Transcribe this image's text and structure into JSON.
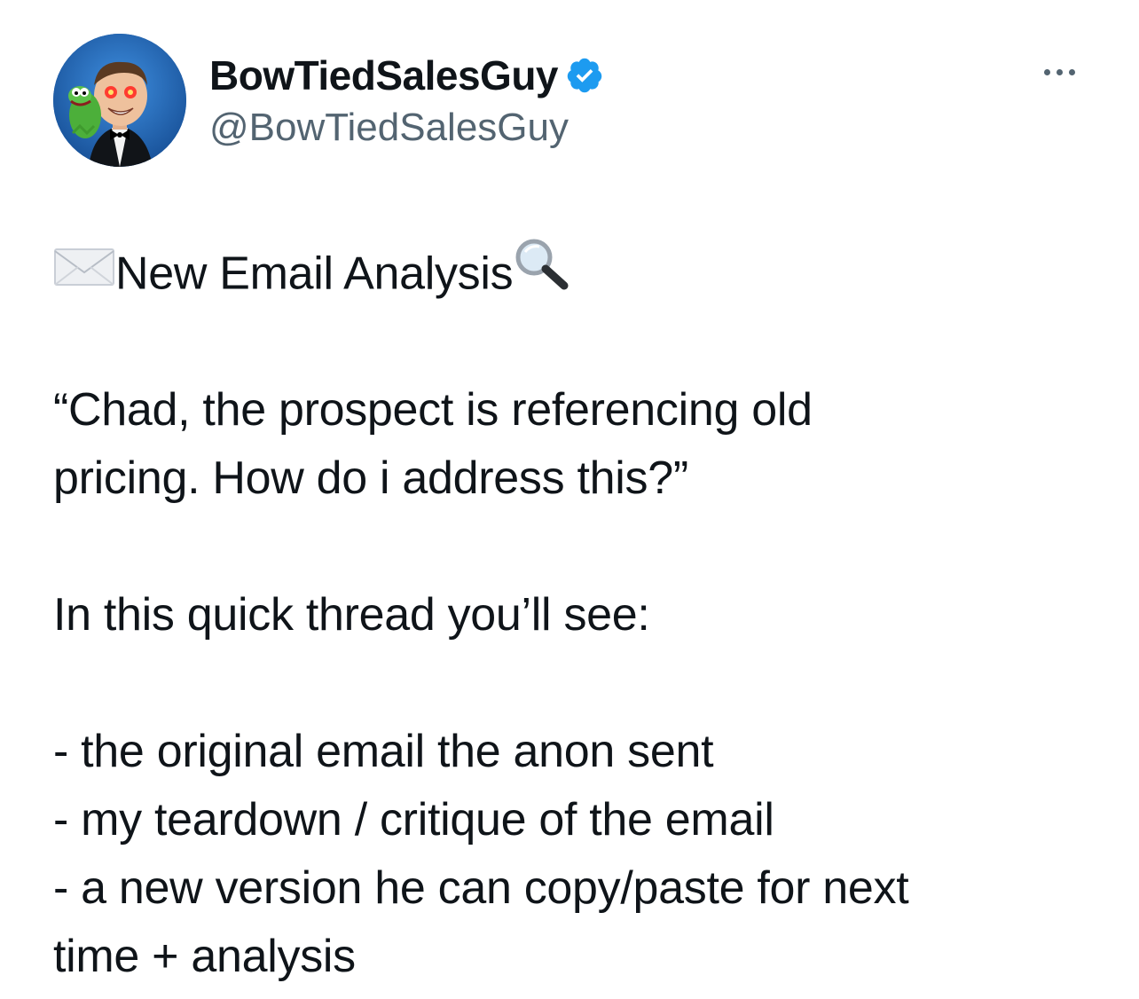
{
  "author": {
    "display_name": "BowTiedSalesGuy",
    "handle": "@BowTiedSalesGuy",
    "verified": true,
    "avatar_icon": "avatar-image",
    "verified_icon": "verified-badge-icon"
  },
  "menu": {
    "icon": "more-options-icon"
  },
  "tweet": {
    "title_text": "New Email Analysis",
    "title_leading_icon": "envelope-icon",
    "title_trailing_icon": "magnifying-glass-icon",
    "quote_line1": "“Chad, the prospect is referencing old",
    "quote_line2": "pricing. How do i address this?”",
    "intro": "In this quick thread you’ll see:",
    "bullet1": "- the original email the anon sent",
    "bullet2": "- my teardown / critique of the email",
    "bullet3_line1": "- a new version he can copy/paste for next",
    "bullet3_line2": "time + analysis"
  },
  "colors": {
    "text_primary": "#0f1419",
    "text_secondary": "#536471",
    "verified_blue": "#1d9bf0",
    "background": "#ffffff"
  }
}
